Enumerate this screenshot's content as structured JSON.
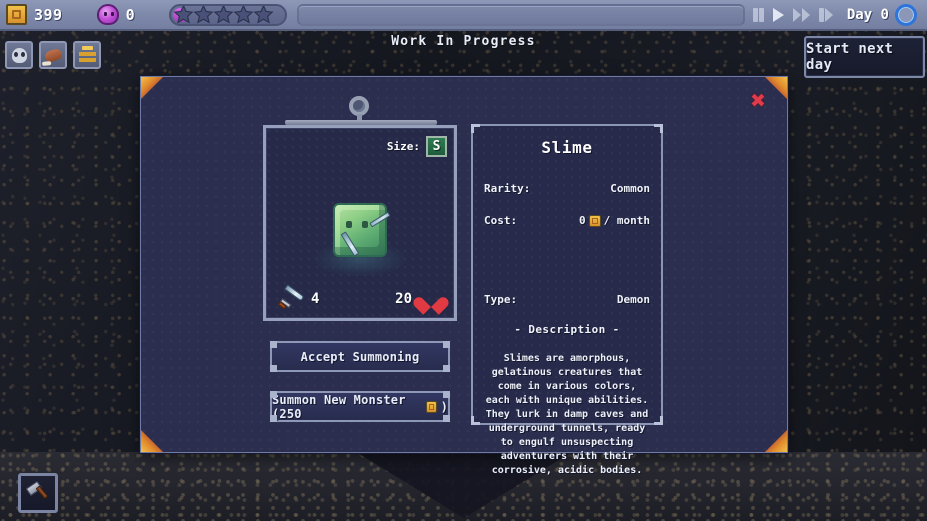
{
  "topbar": {
    "gold_icon": "gold-coin-icon",
    "gold_value": "399",
    "souls_icon": "soul-orb-icon",
    "souls_value": "0",
    "star_rating_total": 5,
    "star_rating_filled": 0,
    "progress_value": 0,
    "controls": [
      {
        "name": "pause-button",
        "glyph": "pause"
      },
      {
        "name": "play-button",
        "glyph": "play"
      },
      {
        "name": "fast-forward-button",
        "glyph": "forward"
      },
      {
        "name": "very-fast-forward-button",
        "glyph": "forward-slow"
      }
    ],
    "day_label": "Day 0",
    "day_ring_color": "#2f74d8"
  },
  "toolbar": {
    "buttons": [
      {
        "name": "monsters-tool",
        "icon": "skull-icon"
      },
      {
        "name": "food-tool",
        "icon": "meat-icon"
      },
      {
        "name": "treasury-tool",
        "icon": "gold-bars-icon"
      }
    ]
  },
  "header": {
    "title": "Work In Progress",
    "start_next_day": "Start next day"
  },
  "dialog": {
    "close_icon": "close-icon",
    "monster_card": {
      "size_label": "Size:",
      "size_value": "S",
      "creature": "slime-sprite",
      "attack_icon": "sword-icon",
      "attack_value": "4",
      "health_value": "20",
      "health_icon": "heart-icon"
    },
    "actions": {
      "accept": "Accept Summoning",
      "summon_prefix": "Summon New Monster (250",
      "summon_suffix": ")"
    },
    "info": {
      "name": "Slime",
      "rarity_label": "Rarity:",
      "rarity_value": "Common",
      "cost_label": "Cost:",
      "cost_value": "0",
      "cost_suffix": "/ month",
      "type_label": "Type:",
      "type_value": "Demon",
      "description_header": "- Description -",
      "description": "Slimes are amorphous, gelatinous creatures that come in various colors, each with unique abilities. They lurk in damp caves and underground tunnels, ready to engulf unsuspecting adventurers with their corrosive, acidic bodies."
    }
  },
  "footer": {
    "build_button_icon": "hammer-icon"
  }
}
